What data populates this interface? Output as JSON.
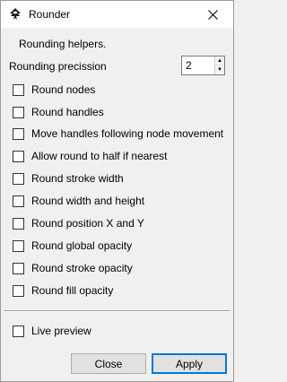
{
  "window": {
    "title": "Rounder",
    "icon": "inkscape-icon"
  },
  "helper_text": "Rounding helpers.",
  "precision": {
    "label": "Rounding precission",
    "value": "2"
  },
  "options": [
    {
      "label": "Round nodes",
      "checked": false
    },
    {
      "label": "Round handles",
      "checked": false
    },
    {
      "label": "Move handles following node movement",
      "checked": false
    },
    {
      "label": "Allow round to half if nearest",
      "checked": false
    },
    {
      "label": "Round stroke width",
      "checked": false
    },
    {
      "label": "Round width and height",
      "checked": false
    },
    {
      "label": "Round position X and Y",
      "checked": false
    },
    {
      "label": "Round global opacity",
      "checked": false
    },
    {
      "label": "Round stroke opacity",
      "checked": false
    },
    {
      "label": "Round fill opacity",
      "checked": false
    }
  ],
  "live_preview": {
    "label": "Live preview",
    "checked": false
  },
  "buttons": {
    "close": "Close",
    "apply": "Apply"
  },
  "colors": {
    "accent": "#0078d7"
  }
}
